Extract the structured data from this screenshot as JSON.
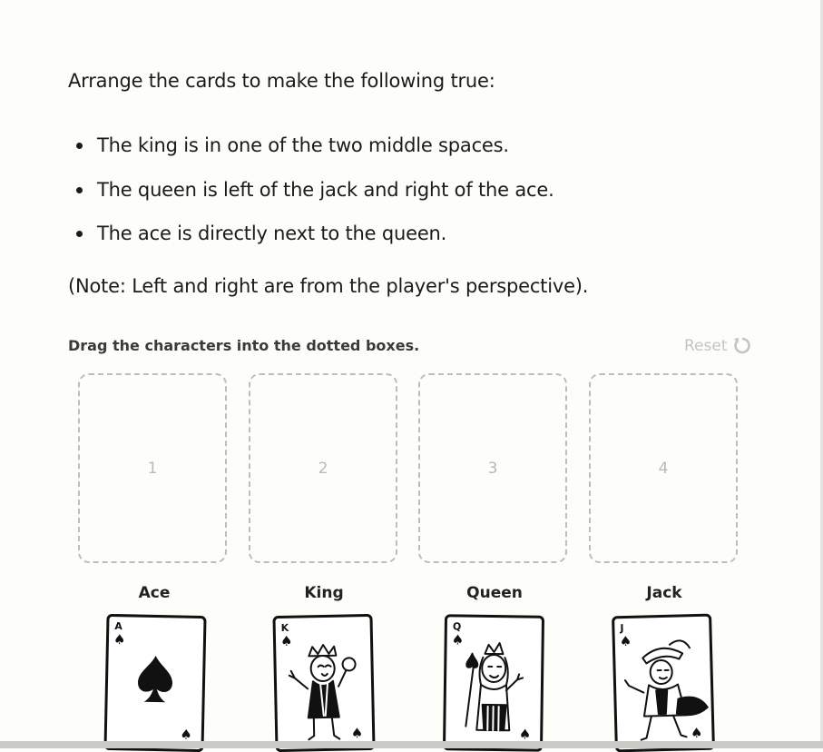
{
  "prompt": {
    "intro": "Arrange the cards to make the following true:",
    "rules": [
      "The king is in one of the two middle spaces.",
      "The queen is left of the jack and right of the ace.",
      "The ace is directly next to the queen."
    ],
    "note": "(Note: Left and right are from the player's perspective)."
  },
  "instruction": "Drag the characters into the dotted boxes.",
  "reset_label": "Reset",
  "slots": [
    "1",
    "2",
    "3",
    "4"
  ],
  "cards": [
    {
      "label": "Ace",
      "rank": "A",
      "suit": "♠"
    },
    {
      "label": "King",
      "rank": "K",
      "suit": "♠"
    },
    {
      "label": "Queen",
      "rank": "Q",
      "suit": "♠"
    },
    {
      "label": "Jack",
      "rank": "J",
      "suit": "♠"
    }
  ]
}
